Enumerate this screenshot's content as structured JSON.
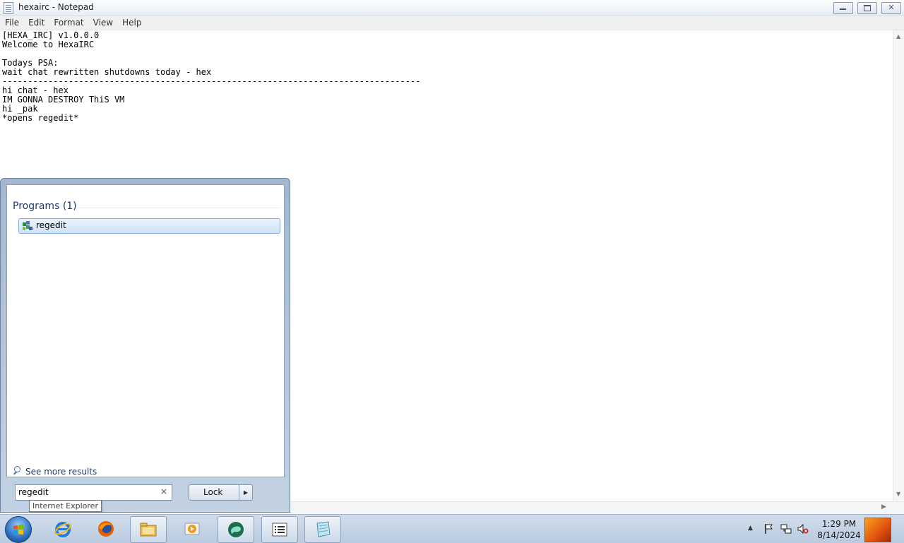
{
  "window": {
    "title": "hexairc - Notepad",
    "controls": {
      "minimize_icon": "minimize-icon",
      "maximize_icon": "maximize-icon",
      "close_glyph": "✕"
    }
  },
  "menubar": {
    "items": [
      "File",
      "Edit",
      "Format",
      "View",
      "Help"
    ]
  },
  "document": {
    "text": "[HEXA_IRC] v1.0.0.0\nWelcome to HexaIRC\n\nTodays PSA:\nwait chat rewritten shutdowns today - hex\n----------------------------------------------------------------------------------\nhi chat - hex\nIM GONNA DESTROY ThiS VM\nhi _pak\n*opens regedit*"
  },
  "start_menu": {
    "programs_header": "Programs (1)",
    "results": [
      {
        "label": "regedit",
        "icon": "regedit-icon"
      }
    ],
    "see_more": "See more results",
    "search": {
      "value": "regedit",
      "clear_glyph": "×"
    },
    "power_button": {
      "label": "Lock",
      "arrow_glyph": "▶"
    }
  },
  "tooltip": {
    "text": "Internet Explorer"
  },
  "taskbar": {
    "pinned": [
      {
        "name": "internet-explorer-icon",
        "running": false
      },
      {
        "name": "firefox-icon",
        "running": false
      },
      {
        "name": "file-explorer-icon",
        "running": true
      },
      {
        "name": "media-player-icon",
        "running": false
      },
      {
        "name": "chat-app-icon",
        "running": true
      },
      {
        "name": "task-manager-icon",
        "running": true
      },
      {
        "name": "notepad-icon",
        "running": true
      }
    ],
    "tray": {
      "overflow_glyph": "▲",
      "icons": [
        "action-center-flag-icon",
        "network-icon",
        "volume-muted-icon"
      ]
    },
    "clock": {
      "time": "1:29 PM",
      "date": "8/14/2024"
    }
  },
  "colors": {
    "taskbar": "#c6d6e8",
    "selection": "#cfe3f8",
    "accent": "#2a6fbf"
  }
}
